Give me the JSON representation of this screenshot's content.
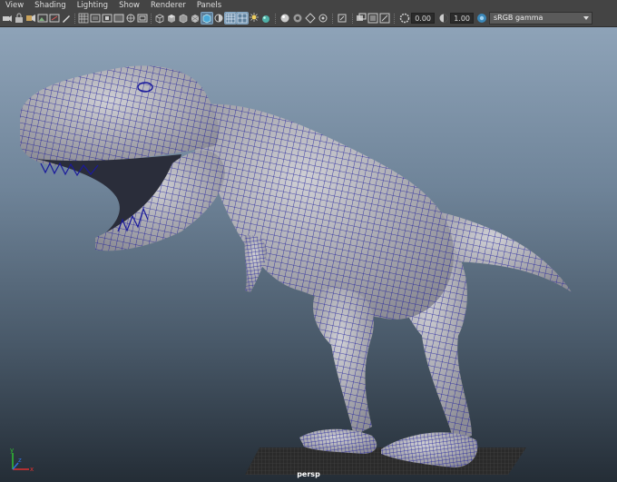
{
  "menu": {
    "items": [
      "View",
      "Shading",
      "Lighting",
      "Show",
      "Renderer",
      "Panels"
    ]
  },
  "toolbar": {
    "exposure_value": "0.00",
    "gamma_value": "1.00",
    "colorspace": {
      "selected": "sRGB gamma"
    },
    "icons": [
      "camera-icon",
      "lock-camera-icon",
      "bookmark-icon",
      "image-plane-icon",
      "2d-pan-icon",
      "grease-pencil-icon",
      "grid-icon",
      "film-gate-icon",
      "resolution-gate-icon",
      "gate-mask-icon",
      "field-chart-icon",
      "safe-action-icon",
      "wireframe-icon",
      "smooth-shade-icon",
      "wireframe-on-shaded-icon",
      "textured-icon",
      "lights-icon",
      "shadows-icon",
      "screen-ao-icon",
      "motion-blur-icon",
      "anti-aliasing-icon",
      "depth-of-field-icon",
      "isolate-select-icon",
      "xray-icon",
      "xray-joints-icon",
      "xray-components-icon",
      "exposure-icon",
      "gamma-icon",
      "colorspace-icon"
    ]
  },
  "viewport": {
    "camera_label": "persp",
    "axes": [
      "x",
      "y",
      "z"
    ]
  },
  "colors": {
    "mesh": "#b9b9bd",
    "wire": "#1a1a9c",
    "bg_top": "#8ea3b8",
    "bg_bottom": "#242d36"
  }
}
